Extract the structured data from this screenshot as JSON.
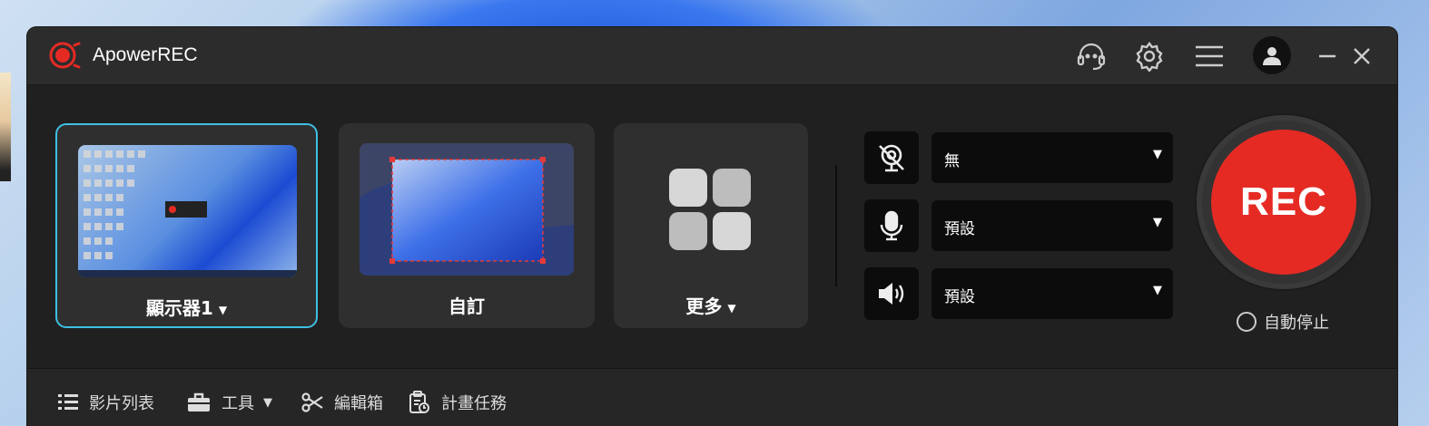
{
  "app": {
    "title": "ApowerREC"
  },
  "modes": [
    {
      "label": "顯示器1",
      "has_dropdown": true,
      "selected": true
    },
    {
      "label": "自訂",
      "has_dropdown": false,
      "selected": false
    },
    {
      "label": "更多",
      "has_dropdown": true,
      "selected": false
    }
  ],
  "devices": {
    "webcam": {
      "icon": "webcam-off-icon",
      "value": "無"
    },
    "microphone": {
      "icon": "microphone-icon",
      "value": "預設"
    },
    "speaker": {
      "icon": "speaker-icon",
      "value": "預設"
    }
  },
  "record": {
    "label": "REC",
    "auto_stop_label": "自動停止",
    "color": "#e52a24"
  },
  "bottom_menu": [
    {
      "label": "影片列表",
      "icon": "list-icon"
    },
    {
      "label": "工具",
      "icon": "toolbox-icon",
      "has_dropdown": true
    },
    {
      "label": "編輯箱",
      "icon": "scissors-icon"
    },
    {
      "label": "計畫任務",
      "icon": "schedule-clipboard-icon"
    }
  ],
  "colors": {
    "accent": "#3ec0e4",
    "rec": "#e52a24",
    "window_bg": "#2b2b2b"
  }
}
